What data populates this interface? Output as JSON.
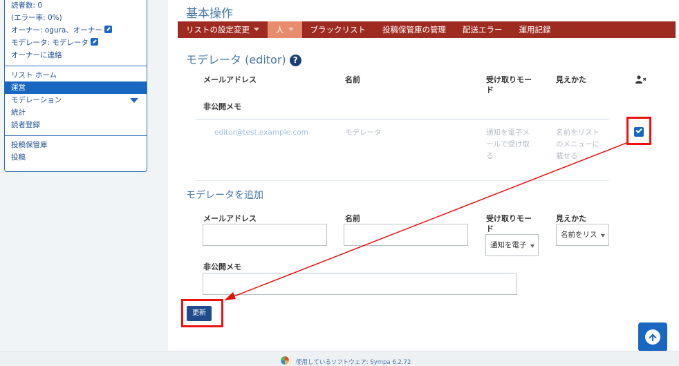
{
  "sidebar": {
    "stats": [
      "読者数: 0",
      "(エラー率: 0%)",
      "オーナー: ogura、オーナー",
      "モデレータ: モデレータ"
    ],
    "contact_owner": "オーナーに連絡",
    "nav": [
      "リスト ホーム",
      "運営",
      "モデレーション",
      "統計",
      "読者登録"
    ],
    "archive": [
      "投稿保管庫",
      "投稿"
    ]
  },
  "page_title": "基本操作",
  "menu": {
    "items": [
      "リストの設定変更",
      "人",
      "ブラックリスト",
      "投稿保管庫の管理",
      "配送エラー",
      "運用記録"
    ]
  },
  "section_title": "モデレータ (editor)",
  "help_glyph": "?",
  "table": {
    "headers": {
      "email": "メールアドレス",
      "name": "名前",
      "reception_line1": "受け取りモー",
      "reception_line2": "ド",
      "visibility": "見えかた",
      "memo": "非公開メモ"
    },
    "row": {
      "email": "editor@test.example.com",
      "name": "モデレータ",
      "reception": [
        "通知を電子メ",
        "ールで受け取",
        "る"
      ],
      "visibility": [
        "名前をリスト",
        "のメニューに",
        "載せる"
      ]
    }
  },
  "add_form": {
    "title": "モデレータを追加",
    "email_label": "メールアドレス",
    "name_label": "名前",
    "reception_label_line1": "受け取りモー",
    "reception_label_line2": "ド",
    "visibility_label": "見えかた",
    "reception_value": "通知を電子",
    "visibility_value": "名前をリス",
    "memo_label": "非公開メモ",
    "submit": "更新"
  },
  "footer": {
    "text": "使用しているソフトウェア: Sympa 6.2.72"
  },
  "colors": {
    "menubar": "#9e2b22",
    "menu_selected": "#e88c6e",
    "accent": "#1a67c1",
    "annotation": "#e11111"
  }
}
